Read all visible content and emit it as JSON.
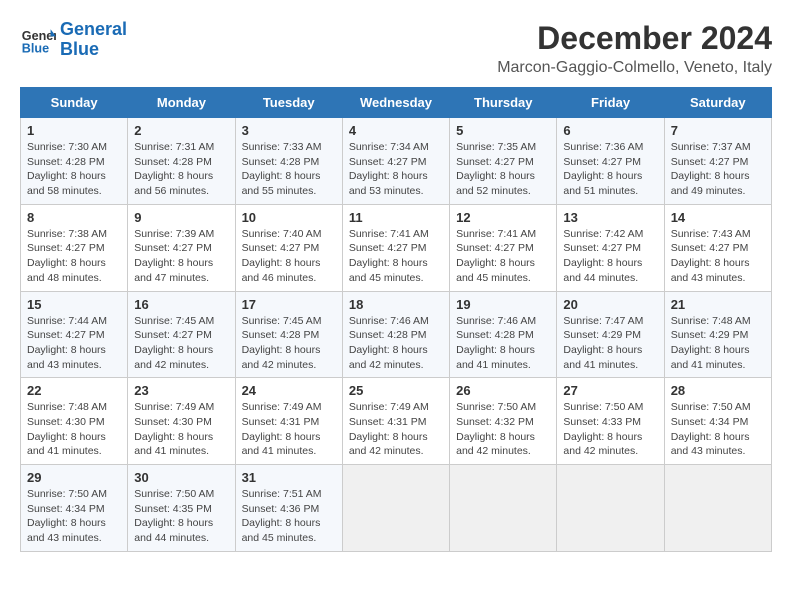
{
  "header": {
    "logo_line1": "General",
    "logo_line2": "Blue",
    "month": "December 2024",
    "location": "Marcon-Gaggio-Colmello, Veneto, Italy"
  },
  "columns": [
    "Sunday",
    "Monday",
    "Tuesday",
    "Wednesday",
    "Thursday",
    "Friday",
    "Saturday"
  ],
  "weeks": [
    [
      {
        "day": "1",
        "sunrise": "7:30 AM",
        "sunset": "4:28 PM",
        "daylight": "8 hours and 58 minutes."
      },
      {
        "day": "2",
        "sunrise": "7:31 AM",
        "sunset": "4:28 PM",
        "daylight": "8 hours and 56 minutes."
      },
      {
        "day": "3",
        "sunrise": "7:33 AM",
        "sunset": "4:28 PM",
        "daylight": "8 hours and 55 minutes."
      },
      {
        "day": "4",
        "sunrise": "7:34 AM",
        "sunset": "4:27 PM",
        "daylight": "8 hours and 53 minutes."
      },
      {
        "day": "5",
        "sunrise": "7:35 AM",
        "sunset": "4:27 PM",
        "daylight": "8 hours and 52 minutes."
      },
      {
        "day": "6",
        "sunrise": "7:36 AM",
        "sunset": "4:27 PM",
        "daylight": "8 hours and 51 minutes."
      },
      {
        "day": "7",
        "sunrise": "7:37 AM",
        "sunset": "4:27 PM",
        "daylight": "8 hours and 49 minutes."
      }
    ],
    [
      {
        "day": "8",
        "sunrise": "7:38 AM",
        "sunset": "4:27 PM",
        "daylight": "8 hours and 48 minutes."
      },
      {
        "day": "9",
        "sunrise": "7:39 AM",
        "sunset": "4:27 PM",
        "daylight": "8 hours and 47 minutes."
      },
      {
        "day": "10",
        "sunrise": "7:40 AM",
        "sunset": "4:27 PM",
        "daylight": "8 hours and 46 minutes."
      },
      {
        "day": "11",
        "sunrise": "7:41 AM",
        "sunset": "4:27 PM",
        "daylight": "8 hours and 45 minutes."
      },
      {
        "day": "12",
        "sunrise": "7:41 AM",
        "sunset": "4:27 PM",
        "daylight": "8 hours and 45 minutes."
      },
      {
        "day": "13",
        "sunrise": "7:42 AM",
        "sunset": "4:27 PM",
        "daylight": "8 hours and 44 minutes."
      },
      {
        "day": "14",
        "sunrise": "7:43 AM",
        "sunset": "4:27 PM",
        "daylight": "8 hours and 43 minutes."
      }
    ],
    [
      {
        "day": "15",
        "sunrise": "7:44 AM",
        "sunset": "4:27 PM",
        "daylight": "8 hours and 43 minutes."
      },
      {
        "day": "16",
        "sunrise": "7:45 AM",
        "sunset": "4:27 PM",
        "daylight": "8 hours and 42 minutes."
      },
      {
        "day": "17",
        "sunrise": "7:45 AM",
        "sunset": "4:28 PM",
        "daylight": "8 hours and 42 minutes."
      },
      {
        "day": "18",
        "sunrise": "7:46 AM",
        "sunset": "4:28 PM",
        "daylight": "8 hours and 42 minutes."
      },
      {
        "day": "19",
        "sunrise": "7:46 AM",
        "sunset": "4:28 PM",
        "daylight": "8 hours and 41 minutes."
      },
      {
        "day": "20",
        "sunrise": "7:47 AM",
        "sunset": "4:29 PM",
        "daylight": "8 hours and 41 minutes."
      },
      {
        "day": "21",
        "sunrise": "7:48 AM",
        "sunset": "4:29 PM",
        "daylight": "8 hours and 41 minutes."
      }
    ],
    [
      {
        "day": "22",
        "sunrise": "7:48 AM",
        "sunset": "4:30 PM",
        "daylight": "8 hours and 41 minutes."
      },
      {
        "day": "23",
        "sunrise": "7:49 AM",
        "sunset": "4:30 PM",
        "daylight": "8 hours and 41 minutes."
      },
      {
        "day": "24",
        "sunrise": "7:49 AM",
        "sunset": "4:31 PM",
        "daylight": "8 hours and 41 minutes."
      },
      {
        "day": "25",
        "sunrise": "7:49 AM",
        "sunset": "4:31 PM",
        "daylight": "8 hours and 42 minutes."
      },
      {
        "day": "26",
        "sunrise": "7:50 AM",
        "sunset": "4:32 PM",
        "daylight": "8 hours and 42 minutes."
      },
      {
        "day": "27",
        "sunrise": "7:50 AM",
        "sunset": "4:33 PM",
        "daylight": "8 hours and 42 minutes."
      },
      {
        "day": "28",
        "sunrise": "7:50 AM",
        "sunset": "4:34 PM",
        "daylight": "8 hours and 43 minutes."
      }
    ],
    [
      {
        "day": "29",
        "sunrise": "7:50 AM",
        "sunset": "4:34 PM",
        "daylight": "8 hours and 43 minutes."
      },
      {
        "day": "30",
        "sunrise": "7:50 AM",
        "sunset": "4:35 PM",
        "daylight": "8 hours and 44 minutes."
      },
      {
        "day": "31",
        "sunrise": "7:51 AM",
        "sunset": "4:36 PM",
        "daylight": "8 hours and 45 minutes."
      },
      null,
      null,
      null,
      null
    ]
  ]
}
